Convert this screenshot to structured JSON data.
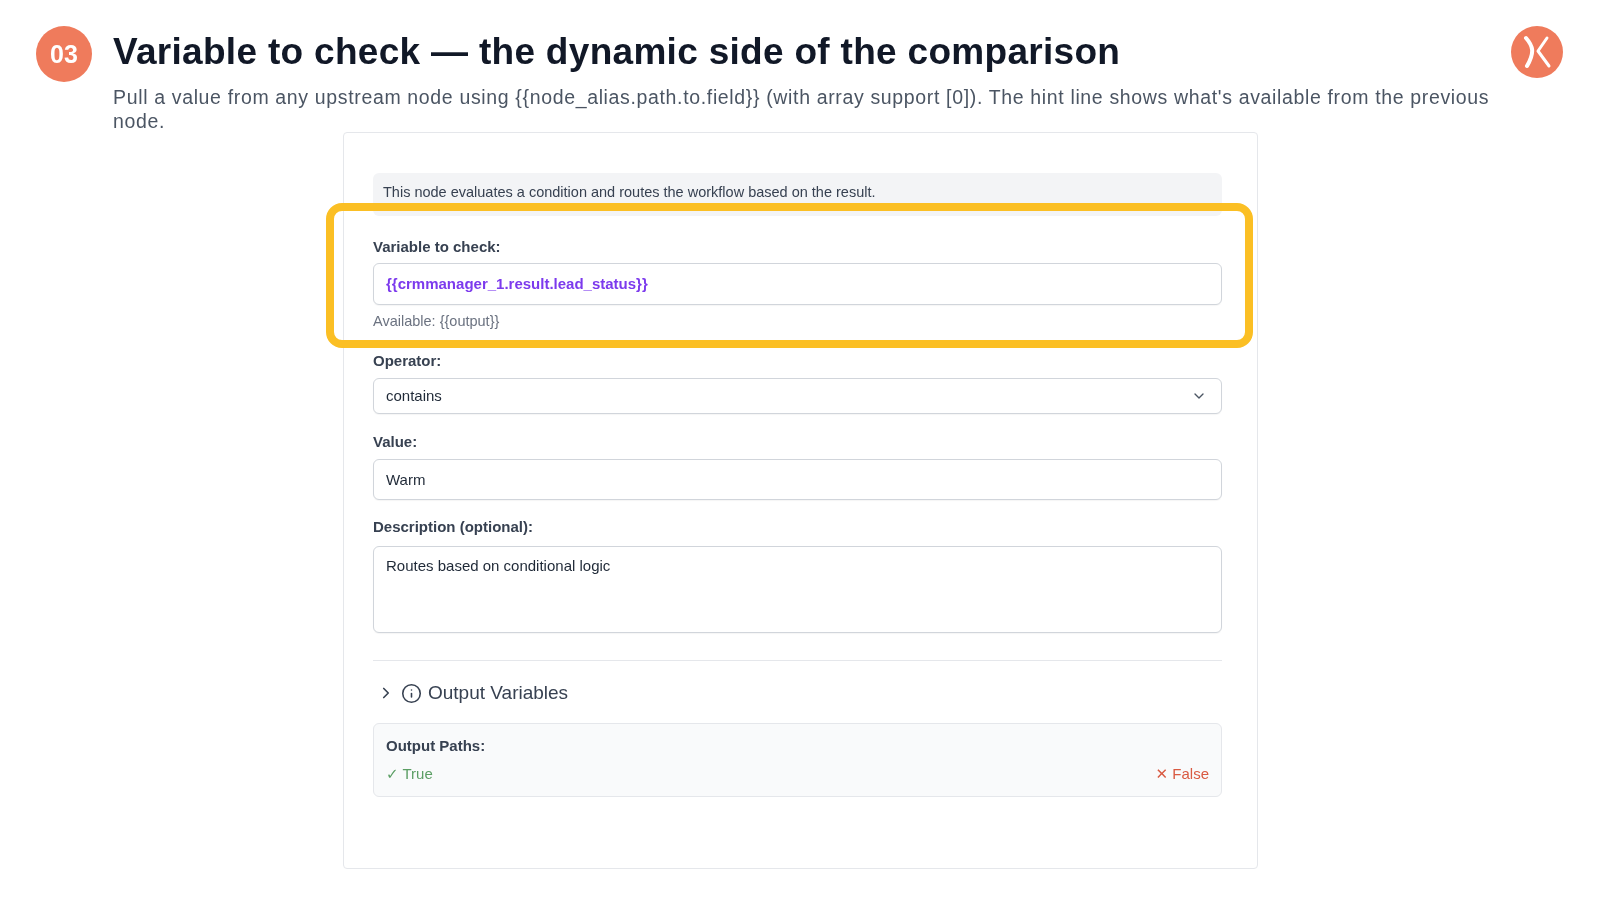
{
  "step": {
    "number": "03",
    "title": "Variable to check — the dynamic side of the comparison",
    "description": "Pull a value from any upstream node using {{node_alias.path.to.field}} (with array support [0]). The hint line shows what's available from the previous node."
  },
  "panel": {
    "info": "This node evaluates a condition and routes the workflow based on the result.",
    "fields": [
      {
        "kind": "variable",
        "label": "Variable to check:",
        "value": "{{crmmanager_1.result.lead_status}}",
        "hint": "Available: {{output}}",
        "highlighted": true
      },
      {
        "kind": "select",
        "label": "Operator:",
        "value": "contains",
        "highlighted": false
      },
      {
        "kind": "text",
        "label": "Value:",
        "value": "Warm",
        "highlighted": false
      },
      {
        "kind": "textarea",
        "label": "Description (optional):",
        "value": "Routes based on conditional logic",
        "highlighted": false
      }
    ],
    "output_variables": {
      "label": "Output Variables",
      "expanded": false
    },
    "output_paths": {
      "label": "Output Paths:",
      "paths": [
        {
          "kind": "pass",
          "label": "✓ True"
        },
        {
          "kind": "fail",
          "label": "✕ False"
        }
      ]
    }
  }
}
